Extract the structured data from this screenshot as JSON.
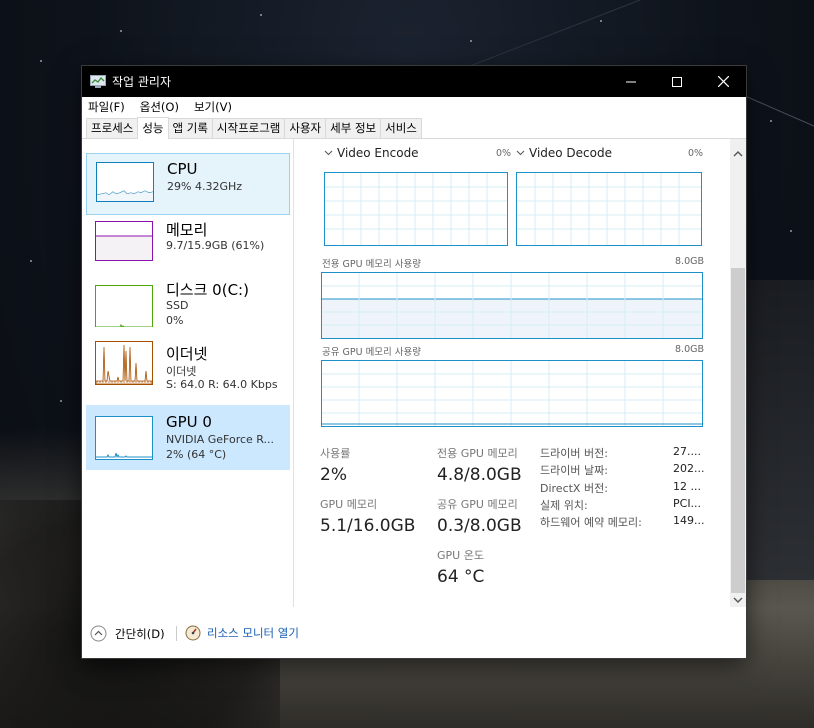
{
  "window": {
    "title": "작업 관리자"
  },
  "menu": {
    "items": [
      "파일(F)",
      "옵션(O)",
      "보기(V)"
    ]
  },
  "tabs": [
    "프로세스",
    "성능",
    "앱 기록",
    "시작프로그램",
    "사용자",
    "세부 정보",
    "서비스"
  ],
  "sidebar": {
    "cpu": {
      "title": "CPU",
      "line1": "29% 4.32GHz"
    },
    "mem": {
      "title": "메모리",
      "line1": "9.7/15.9GB (61%)"
    },
    "disk": {
      "title": "디스크 0(C:)",
      "line1": "SSD",
      "line2": "0%"
    },
    "eth": {
      "title": "이더넷",
      "line1": "이더넷",
      "line2": "S:  64.0  R:  64.0 Kbps"
    },
    "gpu": {
      "title": "GPU 0",
      "line1": "NVIDIA GeForce R...",
      "line2": "2%  (64 °C)"
    }
  },
  "main": {
    "encode": {
      "label": "Video Encode",
      "pct": "0%"
    },
    "decode": {
      "label": "Video Decode",
      "pct": "0%"
    },
    "dedicated_graph": {
      "label": "전용 GPU 메모리 사용량",
      "max": "8.0GB"
    },
    "shared_graph": {
      "label": "공유 GPU 메모리 사용량",
      "max": "8.0GB"
    },
    "stats": {
      "usage_label": "사용률",
      "usage_value": "2%",
      "gpumem_label": "GPU 메모리",
      "gpumem_value": "5.1/16.0GB",
      "dedicated_label": "전용 GPU 메모리",
      "dedicated_value": "4.8/8.0GB",
      "shared_label": "공유 GPU 메모리",
      "shared_value": "0.3/8.0GB",
      "temp_label": "GPU 온도",
      "temp_value": "64 °C"
    },
    "info": [
      {
        "label": "드라이버 버전:",
        "value": "27...."
      },
      {
        "label": "드라이버 날짜:",
        "value": "202..."
      },
      {
        "label": "DirectX 버전:",
        "value": "12 ..."
      },
      {
        "label": "실제 위치:",
        "value": "PCI..."
      },
      {
        "label": "하드웨어 예약 메모리:",
        "value": "149..."
      }
    ]
  },
  "footer": {
    "collapse": "간단히(D)",
    "resmon": "리소스 모니터 열기"
  },
  "colors": {
    "cpu": "#117dbb",
    "memory": "#8b12ae",
    "disk": "#4da60c",
    "ethernet": "#a74f01",
    "gpu": "#1e90c8"
  }
}
